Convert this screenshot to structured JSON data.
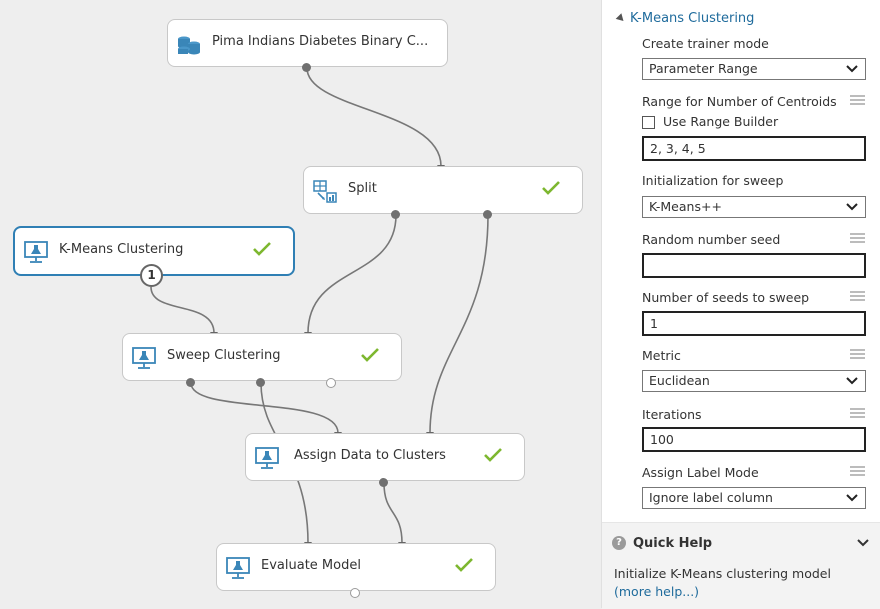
{
  "canvas": {
    "nodes": {
      "pima": {
        "label": "Pima Indians Diabetes Binary C...",
        "icon": "dataset-icon",
        "status": ""
      },
      "split": {
        "label": "Split",
        "icon": "split-data-icon",
        "status": "completed"
      },
      "kmeans": {
        "label": "K-Means Clustering",
        "icon": "module-icon",
        "status": "completed",
        "badge": "1"
      },
      "sweep": {
        "label": "Sweep Clustering",
        "icon": "module-icon",
        "status": "completed"
      },
      "assign": {
        "label": "Assign Data to Clusters",
        "icon": "module-icon",
        "status": "completed"
      },
      "evaluate": {
        "label": "Evaluate Model",
        "icon": "module-icon",
        "status": "completed"
      }
    }
  },
  "properties": {
    "title": "K-Means Clustering",
    "create_trainer_mode": {
      "label": "Create trainer mode",
      "value": "Parameter Range"
    },
    "range_centroids": {
      "label": "Range for Number of Centroids",
      "checkbox_label": "Use Range Builder",
      "checked": false,
      "value": "2, 3, 4, 5"
    },
    "init_sweep": {
      "label": "Initialization for sweep",
      "value": "K-Means++"
    },
    "random_seed": {
      "label": "Random number seed",
      "value": ""
    },
    "num_seeds": {
      "label": "Number of seeds to sweep",
      "value": "1"
    },
    "metric": {
      "label": "Metric",
      "value": "Euclidean"
    },
    "iterations": {
      "label": "Iterations",
      "value": "100"
    },
    "assign_label_mode": {
      "label": "Assign Label Mode",
      "value": "Ignore label column"
    }
  },
  "quick_help": {
    "title": "Quick Help",
    "text": "Initialize K-Means clustering model",
    "link": "(more help...)"
  },
  "colors": {
    "accent": "#2f7fb4",
    "check": "#7db72f",
    "link": "#1f6b9c"
  }
}
